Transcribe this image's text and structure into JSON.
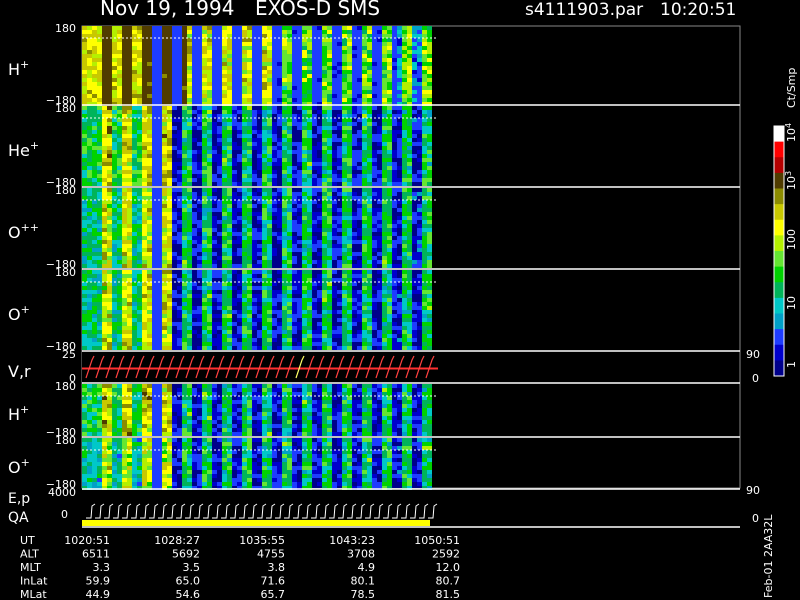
{
  "header": {
    "date": "Nov 19, 1994",
    "instrument": "EXOS-D SMS",
    "file": "s4111903.par",
    "time": "10:20:51"
  },
  "chart_data": {
    "type": "heatmap",
    "panels": [
      {
        "label": "H",
        "sup": "+",
        "ymax": "180",
        "ymin": "−180",
        "intensity": 0.75,
        "fill_fraction": 0.0
      },
      {
        "label": "He",
        "sup": "+",
        "ymax": "180",
        "ymin": "−180",
        "intensity": 0.45,
        "fill_fraction": 0.0
      },
      {
        "label": "O",
        "sup": "++",
        "ymax": "180",
        "ymin": "−180",
        "intensity": 0.4,
        "fill_fraction": 0.0
      },
      {
        "label": "O",
        "sup": "+",
        "ymax": "180",
        "ymin": "−180",
        "intensity": 0.4,
        "fill_fraction": 0.0
      },
      {
        "label": "V,r",
        "sup": "",
        "ymax": "25",
        "ymin": "0",
        "right_top": "90",
        "right_bottom": "0",
        "line_panel": true
      },
      {
        "label": "H",
        "sup": "+",
        "ymax": "180",
        "ymin": "−180",
        "intensity": 0.45,
        "fill_fraction": 0.0
      },
      {
        "label": "O",
        "sup": "+",
        "ymax": "180",
        "ymin": "−180",
        "intensity": 0.35,
        "fill_fraction": 0.0
      }
    ],
    "ep_panel": {
      "label1": "E,p",
      "label2": "QA",
      "ymax": "4000",
      "ymin": "0",
      "right_top": "90",
      "right_bottom": "0"
    },
    "colorbar": {
      "title": "Ct/Smp",
      "ticks": [
        "10",
        "10",
        "10",
        "100",
        "10",
        "1"
      ],
      "tick_sup": [
        "4",
        "3",
        "",
        "",
        "",
        ""
      ],
      "scale": "log",
      "range": [
        1,
        10000
      ],
      "colors": [
        "#00008b",
        "#0000cd",
        "#1e3cff",
        "#00a0c8",
        "#00c8c8",
        "#00b45a",
        "#00d200",
        "#64e632",
        "#b4f000",
        "#ffff00",
        "#c8c800",
        "#8c8c00",
        "#503c00",
        "#b40000",
        "#ff0000",
        "#ffffff"
      ]
    },
    "x_axis": {
      "rows": [
        {
          "label": "UT",
          "values": [
            "1020:51",
            "1028:27",
            "1035:55",
            "1043:23",
            "1050:51"
          ]
        },
        {
          "label": "ALT",
          "values": [
            "6511",
            "5692",
            "4755",
            "3708",
            "2592"
          ]
        },
        {
          "label": "MLT",
          "values": [
            "3.3",
            "3.5",
            "3.8",
            "4.9",
            "12.0"
          ]
        },
        {
          "label": "InLat",
          "values": [
            "59.9",
            "65.0",
            "71.6",
            "80.1",
            "80.7"
          ]
        },
        {
          "label": "MLat",
          "values": [
            "44.9",
            "54.6",
            "65.7",
            "78.5",
            "81.5"
          ]
        }
      ]
    },
    "footer_note": "Feb-01 2AA32L"
  }
}
